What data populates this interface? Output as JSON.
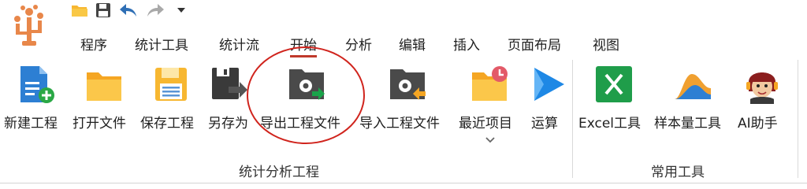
{
  "tabs": [
    {
      "label": "程序"
    },
    {
      "label": "统计工具"
    },
    {
      "label": "统计流"
    },
    {
      "label": "开始",
      "active": true
    },
    {
      "label": "分析"
    },
    {
      "label": "编辑"
    },
    {
      "label": "插入"
    },
    {
      "label": "页面布局"
    },
    {
      "label": "视图"
    }
  ],
  "ribbon": {
    "groups": [
      {
        "label": "统计分析工程",
        "commands": [
          {
            "label": "新建工程",
            "icon": "new-project-icon"
          },
          {
            "label": "打开文件",
            "icon": "open-folder-icon"
          },
          {
            "label": "保存工程",
            "icon": "save-project-icon"
          },
          {
            "label": "另存为",
            "icon": "save-as-icon"
          },
          {
            "label": "导出工程文件",
            "icon": "export-project-icon",
            "highlighted": true
          },
          {
            "label": "导入工程文件",
            "icon": "import-project-icon"
          },
          {
            "label": "最近项目",
            "icon": "recent-projects-icon",
            "has_dropdown": true
          },
          {
            "label": "运算",
            "icon": "run-icon"
          }
        ]
      },
      {
        "label": "常用工具",
        "commands": [
          {
            "label": "Excel工具",
            "icon": "excel-icon"
          },
          {
            "label": "样本量工具",
            "icon": "sample-size-icon"
          },
          {
            "label": "AI助手",
            "icon": "ai-assistant-icon"
          }
        ]
      }
    ]
  },
  "colors": {
    "accent_red": "#d0241d",
    "folder_yellow": "#f7b731",
    "excel_green": "#1f9d4a",
    "run_blue": "#1e88e5",
    "undo_blue": "#2f6fb5"
  }
}
